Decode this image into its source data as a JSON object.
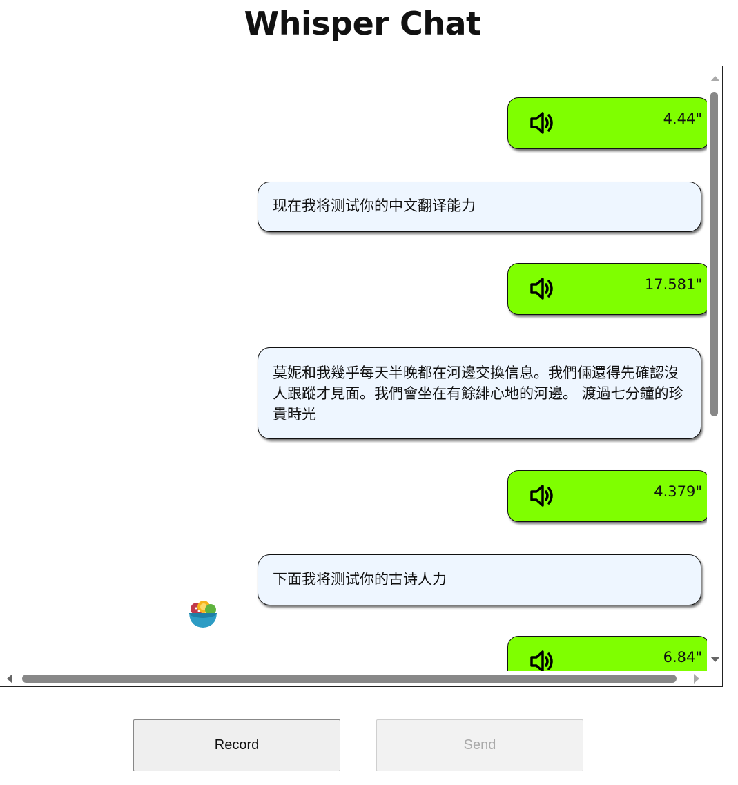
{
  "app": {
    "title": "Whisper Chat"
  },
  "messages": [
    {
      "type": "audio",
      "duration": "4.44\""
    },
    {
      "type": "text",
      "text": "现在我将测试你的中文翻译能力"
    },
    {
      "type": "audio",
      "duration": "17.581\""
    },
    {
      "type": "text",
      "text": "莫妮和我幾乎每天半晚都在河邊交換信息。我們倆還得先確認沒人跟蹤才見面。我們會坐在有餘緋心地的河邊。 渡過七分鐘的珍貴時光"
    },
    {
      "type": "audio",
      "duration": "4.379\""
    },
    {
      "type": "text",
      "text": "下面我将测试你的古诗人力"
    },
    {
      "type": "audio",
      "duration": "6.84\""
    }
  ],
  "controls": {
    "record_label": "Record",
    "send_label": "Send"
  },
  "colors": {
    "audio_bubble": "#7fff00",
    "text_bubble": "#eef6ff"
  },
  "icons": {
    "speaker": "speaker-icon",
    "avatar": "salad-bowl-icon"
  }
}
